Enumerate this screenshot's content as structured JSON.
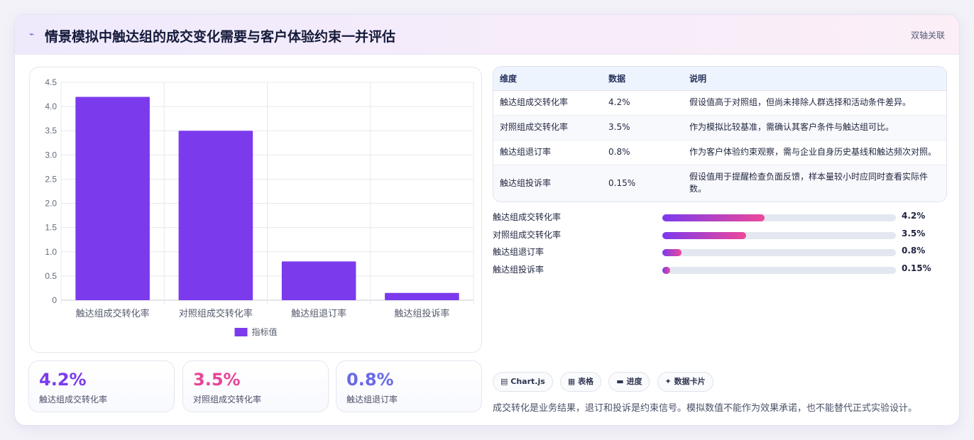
{
  "header": {
    "icon": "sparkle-icon",
    "title": "情景模拟中触达组的成交变化需要与客户体验约束一并评估",
    "tag": "双轴关联"
  },
  "chart_data": {
    "type": "bar",
    "categories": [
      "触达组成交转化率",
      "对照组成交转化率",
      "触达组退订率",
      "触达组投诉率"
    ],
    "series": [
      {
        "name": "指标值",
        "values": [
          4.2,
          3.5,
          0.8,
          0.15
        ]
      }
    ],
    "yticks": [
      "0",
      "0.5",
      "1.0",
      "1.5",
      "2.0",
      "2.5",
      "3.0",
      "3.5",
      "4.0",
      "4.5"
    ],
    "ylim": [
      0,
      4.5
    ],
    "grid": true,
    "legend_position": "bottom",
    "color": "#7c3aed"
  },
  "stats": [
    {
      "value": "4.2%",
      "label": "触达组成交转化率",
      "color": "#7c3aed"
    },
    {
      "value": "3.5%",
      "label": "对照组成交转化率",
      "color": "#e64597"
    },
    {
      "value": "0.8%",
      "label": "触达组退订率",
      "color": "#6a6ae6"
    }
  ],
  "table": {
    "headers": [
      "维度",
      "数据",
      "说明"
    ],
    "rows": [
      [
        "触达组成交转化率",
        "4.2%",
        "假设值高于对照组，但尚未排除人群选择和活动条件差异。"
      ],
      [
        "对照组成交转化率",
        "3.5%",
        "作为模拟比较基准，需确认其客户条件与触达组可比。"
      ],
      [
        "触达组退订率",
        "0.8%",
        "作为客户体验约束观察，需与企业自身历史基线和触达频次对照。"
      ],
      [
        "触达组投诉率",
        "0.15%",
        "假设值用于提醒检查负面反馈，样本量较小时应同时查看实际件数。"
      ]
    ]
  },
  "progress": [
    {
      "label": "触达组成交转化率",
      "value": "4.2%",
      "fraction": 0.4375
    },
    {
      "label": "对照组成交转化率",
      "value": "3.5%",
      "fraction": 0.36
    },
    {
      "label": "触达组退订率",
      "value": "0.8%",
      "fraction": 0.082
    },
    {
      "label": "触达组投诉率",
      "value": "0.15%",
      "fraction": 0.034
    }
  ],
  "chips": [
    {
      "icon": "chart-icon",
      "glyph": "▤",
      "label": "Chart.js"
    },
    {
      "icon": "table-icon",
      "glyph": "▦",
      "label": "表格"
    },
    {
      "icon": "progress-icon",
      "glyph": "▬",
      "label": "进度"
    },
    {
      "icon": "sparkle-icon",
      "glyph": "✦",
      "label": "数据卡片"
    }
  ],
  "footnote": "成交转化是业务结果，退订和投诉是约束信号。模拟数值不能作为效果承诺，也不能替代正式实验设计。"
}
